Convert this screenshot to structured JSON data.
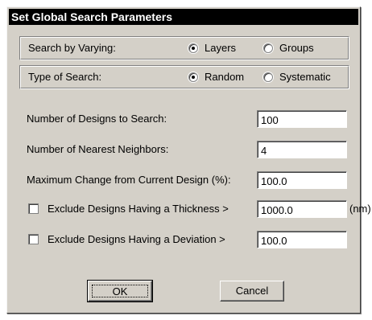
{
  "dialog": {
    "title": "Set Global Search Parameters",
    "search_by": {
      "label": "Search by Varying:",
      "options": [
        "Layers",
        "Groups"
      ],
      "selected": "Layers"
    },
    "search_type": {
      "label": "Type of Search:",
      "options": [
        "Random",
        "Systematic"
      ],
      "selected": "Random"
    },
    "fields": {
      "num_designs": {
        "label": "Number of Designs to Search:",
        "value": "100"
      },
      "num_neighbors": {
        "label": "Number of Nearest Neighbors:",
        "value": "4"
      },
      "max_change": {
        "label": "Maximum Change from Current Design (%):",
        "value": "100.0"
      },
      "exclude_thickness": {
        "label": "Exclude Designs Having a Thickness >",
        "value": "1000.0",
        "unit": "(nm)",
        "checked": false
      },
      "exclude_deviation": {
        "label": "Exclude Designs Having a Deviation >",
        "value": "100.0",
        "checked": false
      }
    },
    "buttons": {
      "ok": "OK",
      "cancel": "Cancel"
    }
  }
}
